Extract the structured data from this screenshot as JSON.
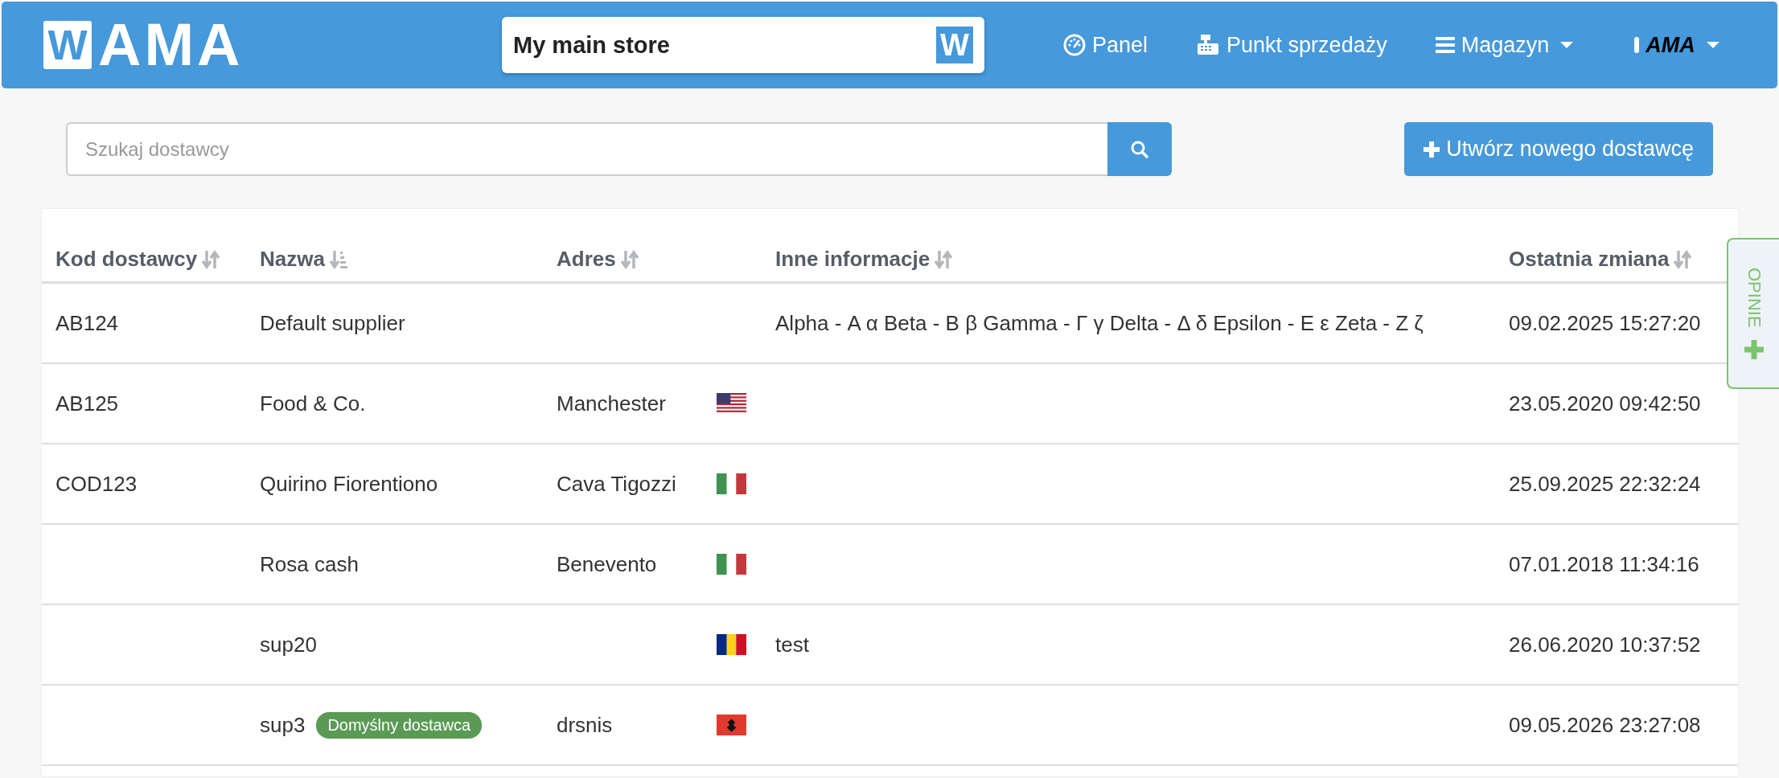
{
  "header": {
    "logo": {
      "mark": "W",
      "text": "AMA"
    },
    "store": {
      "value": "My main store",
      "mark": "W"
    },
    "nav": [
      {
        "kind": "gauge",
        "label": "Panel",
        "dropdown": false
      },
      {
        "kind": "register",
        "label": "Punkt sprzedaży",
        "dropdown": false
      },
      {
        "kind": "menu",
        "label": "Magazyn",
        "dropdown": true
      },
      {
        "kind": "account",
        "label": "AMA",
        "dropdown": true
      }
    ]
  },
  "search": {
    "placeholder": "Szukaj dostawcy"
  },
  "create_button": {
    "label": "Utwórz nowego dostawcę"
  },
  "table": {
    "columns": [
      {
        "label": "Kod dostawcy",
        "kind": "sortable"
      },
      {
        "label": "Nazwa",
        "kind": "sorted"
      },
      {
        "label": "Adres",
        "kind": "sortable"
      },
      {
        "label": "Inne informacje",
        "kind": "sortable"
      },
      {
        "label": "Ostatnia zmiana",
        "kind": "sortable"
      }
    ],
    "rows": [
      {
        "code": "AB124",
        "name": "Default supplier",
        "address": "",
        "other": "Alpha - Α α Beta - Β β Gamma - Γ γ Delta - Δ δ Epsilon - Ε ε Zeta - Ζ ζ",
        "changed": "09.02.2025 15:27:20"
      },
      {
        "code": "AB125",
        "name": "Food & Co.",
        "address": "Manchester",
        "flag": {
          "kind": "us"
        },
        "other": "",
        "changed": "23.05.2020 09:42:50"
      },
      {
        "code": "COD123",
        "name": "Quirino Fiorentiono",
        "address": "Cava Tigozzi",
        "flag": {
          "kind": "it"
        },
        "other": "",
        "changed": "25.09.2025 22:32:24"
      },
      {
        "code": "",
        "name": "Rosa cash",
        "address": "Benevento",
        "flag": {
          "kind": "it"
        },
        "other": "",
        "changed": "07.01.2018 11:34:16"
      },
      {
        "code": "",
        "name": "sup20",
        "address": "",
        "flag": {
          "kind": "ro"
        },
        "other": "test",
        "changed": "26.06.2020 10:37:52"
      },
      {
        "code": "",
        "name": "sup3",
        "badge": "Domyślny dostawca",
        "address": "drsnis",
        "flag": {
          "kind": "al"
        },
        "other": "",
        "changed": "09.05.2026 23:27:08"
      }
    ]
  },
  "feedback_tab": {
    "label": "OPINIE"
  }
}
